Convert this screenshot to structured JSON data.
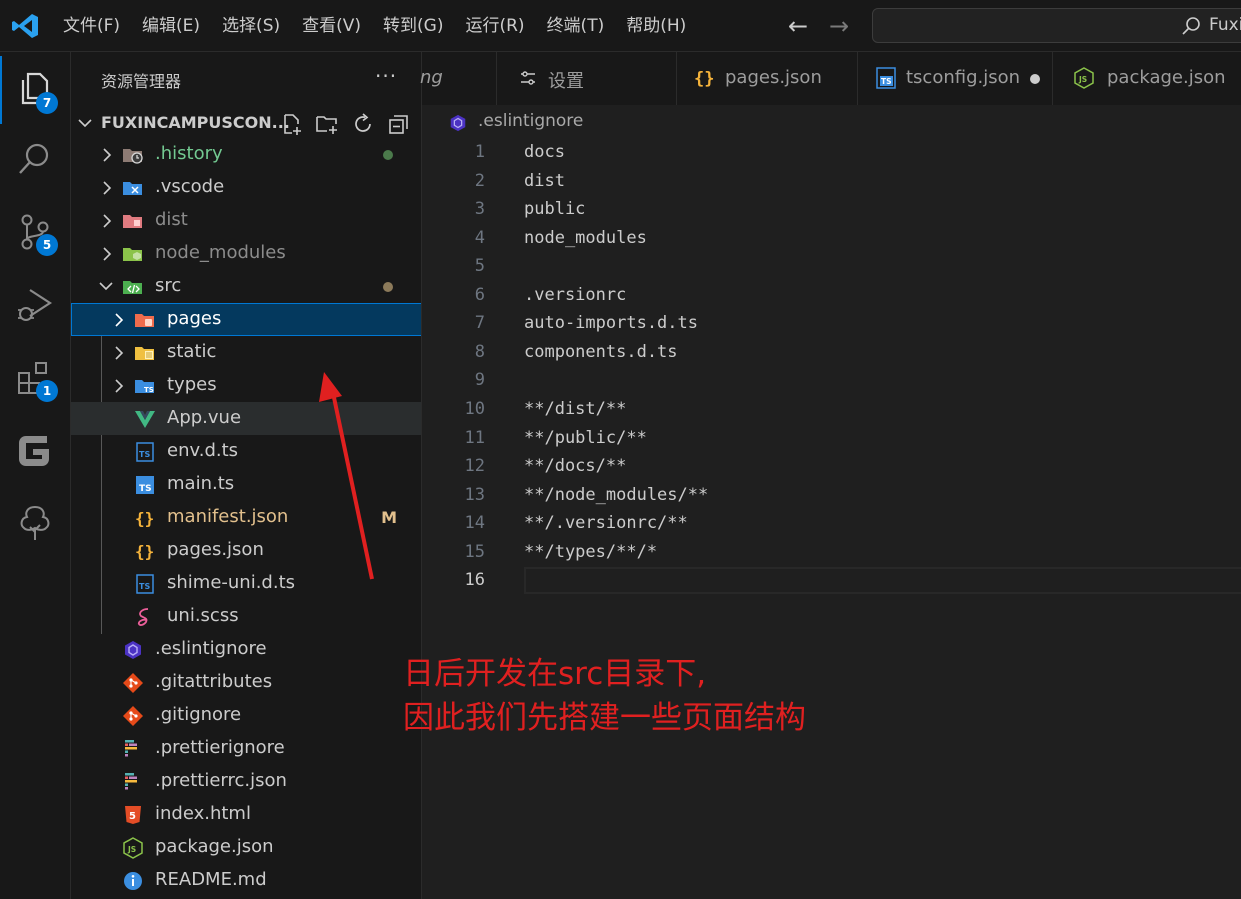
{
  "titlebar": {
    "menu": [
      "文件(F)",
      "编辑(E)",
      "选择(S)",
      "查看(V)",
      "转到(G)",
      "运行(R)",
      "终端(T)",
      "帮助(H)"
    ],
    "command_center_text": "Fuxi"
  },
  "activitybar": {
    "items": [
      {
        "icon": "explorer-icon",
        "badge": "7"
      },
      {
        "icon": "search-icon",
        "badge": ""
      },
      {
        "icon": "source-control-icon",
        "badge": "5"
      },
      {
        "icon": "run-debug-icon",
        "badge": ""
      },
      {
        "icon": "extensions-icon",
        "badge": "1"
      },
      {
        "icon": "gitee-icon",
        "badge": ""
      },
      {
        "icon": "tree-icon",
        "badge": ""
      }
    ]
  },
  "sidebar": {
    "title": "资源管理器",
    "more": "···",
    "project_name": "FUXINCAMPUSCON...",
    "tree": [
      {
        "name": ".history",
        "color": "#73c991",
        "dot": "#4b7a4b"
      },
      {
        "name": ".vscode",
        "color": "#cccccc"
      },
      {
        "name": "dist",
        "color": "#8c8c8c"
      },
      {
        "name": "node_modules",
        "color": "#8c8c8c"
      },
      {
        "name": "src",
        "color": "#cccccc",
        "dot": "#8c7a5a"
      },
      {
        "name": "pages",
        "color": "#ffffff"
      },
      {
        "name": "static",
        "color": "#cccccc"
      },
      {
        "name": "types",
        "color": "#cccccc"
      },
      {
        "name": "App.vue",
        "color": "#cccccc"
      },
      {
        "name": "env.d.ts",
        "color": "#cccccc"
      },
      {
        "name": "main.ts",
        "color": "#cccccc"
      },
      {
        "name": "manifest.json",
        "color": "#e2c08d",
        "mark": "M"
      },
      {
        "name": "pages.json",
        "color": "#cccccc"
      },
      {
        "name": "shime-uni.d.ts",
        "color": "#cccccc"
      },
      {
        "name": "uni.scss",
        "color": "#cccccc"
      },
      {
        "name": ".eslintignore",
        "color": "#cccccc"
      },
      {
        "name": ".gitattributes",
        "color": "#cccccc"
      },
      {
        "name": ".gitignore",
        "color": "#cccccc"
      },
      {
        "name": ".prettierignore",
        "color": "#cccccc"
      },
      {
        "name": ".prettierrc.json",
        "color": "#cccccc"
      },
      {
        "name": "index.html",
        "color": "#cccccc"
      },
      {
        "name": "package.json",
        "color": "#cccccc"
      },
      {
        "name": "README.md",
        "color": "#cccccc"
      }
    ]
  },
  "tabs": [
    {
      "label": "ng",
      "icon": ""
    },
    {
      "label": "设置",
      "icon": "settings-icon"
    },
    {
      "label": "pages.json",
      "icon": "json-icon"
    },
    {
      "label": "tsconfig.json",
      "icon": "tsconfig-icon",
      "modified": true
    },
    {
      "label": "package.json",
      "icon": "nodejs-icon",
      "modified": true
    }
  ],
  "editor": {
    "breadcrumb": ".eslintignore",
    "active_line": 16,
    "lines": [
      "docs",
      "dist",
      "public",
      "node_modules",
      "",
      ".versionrc",
      "auto-imports.d.ts",
      "components.d.ts",
      "",
      "**/dist/**",
      "**/public/**",
      "**/docs/**",
      "**/node_modules/**",
      "**/.versionrc/**",
      "**/types/**/*",
      ""
    ]
  },
  "annotation": {
    "line1": "日后开发在src目录下,",
    "line2": "因此我们先搭建一些页面结构",
    "color": "#e02020"
  }
}
